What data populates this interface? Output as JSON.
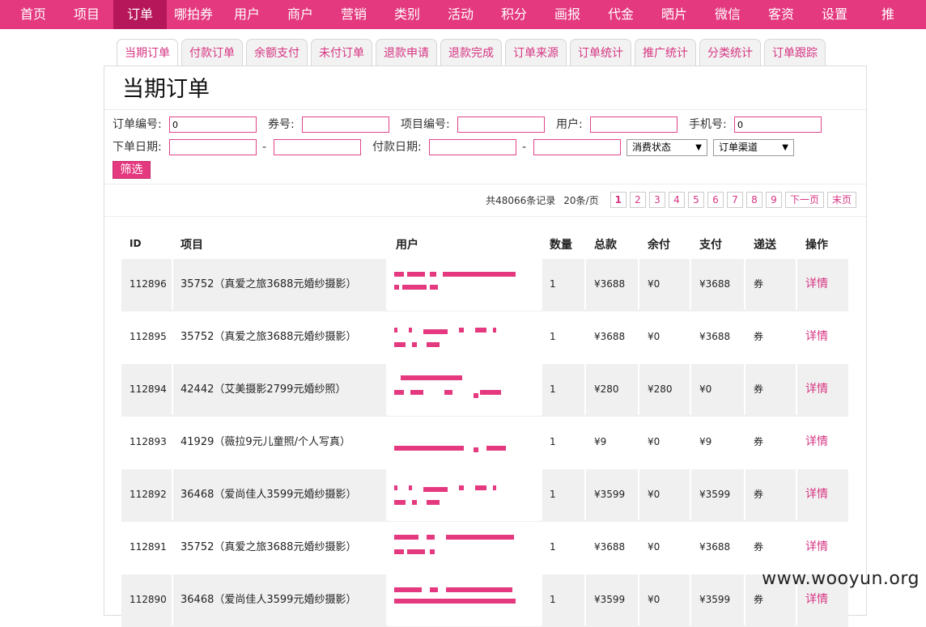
{
  "topnav": [
    "首页",
    "项目",
    "订单",
    "哪拍券",
    "用户",
    "商户",
    "营销",
    "类别",
    "活动",
    "积分",
    "画报",
    "代金",
    "晒片",
    "微信",
    "客资",
    "设置",
    "推"
  ],
  "subtabs": [
    "当期订单",
    "付款订单",
    "余额支付",
    "未付订单",
    "退款申请",
    "退款完成",
    "订单来源",
    "订单统计",
    "推广统计",
    "分类统计",
    "订单跟踪"
  ],
  "page_title": "当期订单",
  "filters": {
    "order_no_label": "订单编号:",
    "order_no_value": "0",
    "coupon_label": "券号:",
    "project_no_label": "项目编号:",
    "user_label": "用户:",
    "phone_label": "手机号:",
    "phone_value": "0",
    "order_date_label": "下单日期:",
    "dash": "-",
    "pay_date_label": "付款日期:",
    "status_select": "消费状态",
    "channel_select": "订单渠道",
    "filter_button": "筛选"
  },
  "pager": {
    "info": "共48066条记录",
    "per_page": "20条/页",
    "pages": [
      "1",
      "2",
      "3",
      "4",
      "5",
      "6",
      "7",
      "8",
      "9"
    ],
    "next": "下一页",
    "last": "末页"
  },
  "table": {
    "headers": [
      "ID",
      "项目",
      "用户",
      "数量",
      "总款",
      "余付",
      "支付",
      "递送",
      "操作"
    ],
    "rows": [
      {
        "id": "112896",
        "project": "35752（真爱之旅3688元婚纱摄影）",
        "qty": "1",
        "total": "¥3688",
        "balance": "¥0",
        "paid": "¥3688",
        "delivery": "券",
        "action": "详情"
      },
      {
        "id": "112895",
        "project": "35752（真爱之旅3688元婚纱摄影）",
        "qty": "1",
        "total": "¥3688",
        "balance": "¥0",
        "paid": "¥3688",
        "delivery": "券",
        "action": "详情"
      },
      {
        "id": "112894",
        "project": "42442（艾美摄影2799元婚纱照）",
        "qty": "1",
        "total": "¥280",
        "balance": "¥280",
        "paid": "¥0",
        "delivery": "券",
        "action": "详情"
      },
      {
        "id": "112893",
        "project": "41929（薇拉9元儿童照/个人写真）",
        "qty": "1",
        "total": "¥9",
        "balance": "¥0",
        "paid": "¥9",
        "delivery": "券",
        "action": "详情"
      },
      {
        "id": "112892",
        "project": "36468（爱尚佳人3599元婚纱摄影）",
        "qty": "1",
        "total": "¥3599",
        "balance": "¥0",
        "paid": "¥3599",
        "delivery": "券",
        "action": "详情"
      },
      {
        "id": "112891",
        "project": "35752（真爱之旅3688元婚纱摄影）",
        "qty": "1",
        "total": "¥3688",
        "balance": "¥0",
        "paid": "¥3688",
        "delivery": "券",
        "action": "详情"
      },
      {
        "id": "112890",
        "project": "36468（爱尚佳人3599元婚纱摄影）",
        "qty": "1",
        "total": "¥3599",
        "balance": "¥0",
        "paid": "¥3599",
        "delivery": "券",
        "action": "详情"
      }
    ]
  },
  "watermark": "www.wooyun.org",
  "colors": {
    "brand": "#e4387f",
    "nav_active": "#b5175a",
    "link": "#d63482"
  }
}
